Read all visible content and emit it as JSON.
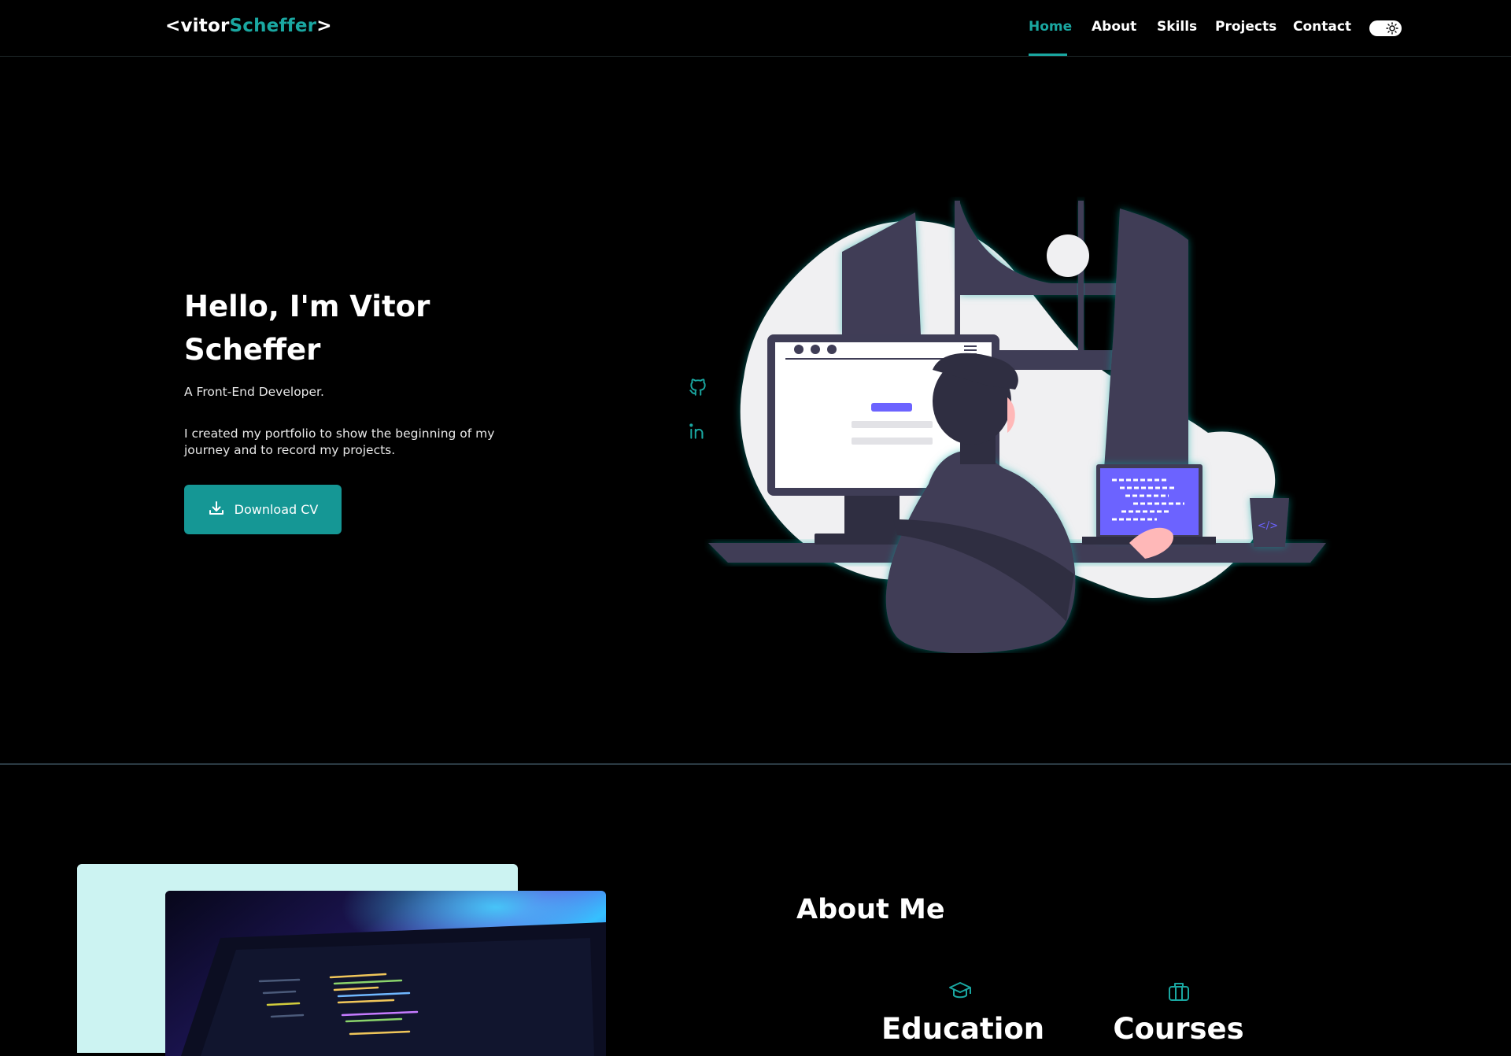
{
  "header": {
    "logo_prefix": "<vitor",
    "logo_accent": "Scheffer",
    "logo_suffix": ">",
    "nav": [
      {
        "label": "Home",
        "active": true
      },
      {
        "label": "About",
        "active": false
      },
      {
        "label": "Skills",
        "active": false
      },
      {
        "label": "Projects",
        "active": false
      },
      {
        "label": "Contact",
        "active": false
      }
    ],
    "theme_toggle_icon": "sun-icon"
  },
  "hero": {
    "title": "Hello, I'm Vitor Scheffer",
    "subtitle": "A Front-End Developer.",
    "description": "I created my portfolio to show the beginning of my journey and to record my projects.",
    "download_label": "Download CV",
    "download_icon": "download-icon",
    "social": [
      "github-icon",
      "linkedin-icon"
    ]
  },
  "about": {
    "title": "About Me",
    "cards": [
      {
        "label": "Education",
        "icon": "graduation-cap-icon"
      },
      {
        "label": "Courses",
        "icon": "briefcase-icon"
      }
    ]
  },
  "colors": {
    "accent": "#1aa7a1",
    "button": "#159795",
    "background": "#000000",
    "about_panel": "#ccf3f2"
  }
}
